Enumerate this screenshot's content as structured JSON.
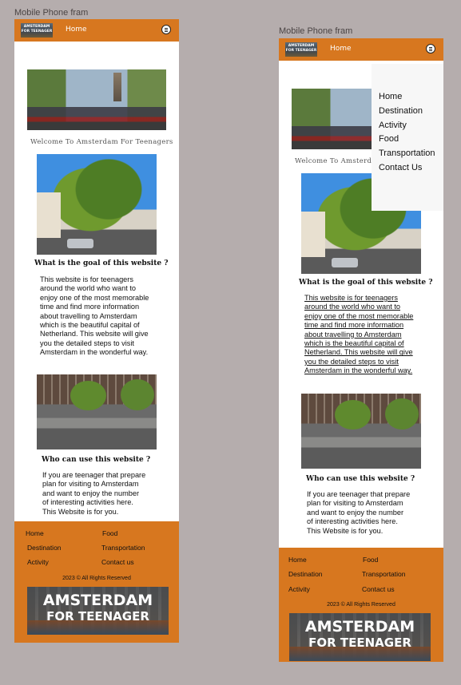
{
  "frames": [
    {
      "label": "Mobile Phone fram"
    },
    {
      "label": "Mobile Phone fram"
    }
  ],
  "nav": {
    "logo_text_line1": "AMSTERDAM",
    "logo_text_line2": "FOR TEENAGER",
    "home_label": "Home",
    "menu_icon": "hamburger-menu-icon"
  },
  "hero": {
    "welcome_text": "Welcome To Amsterdam For Teenagers"
  },
  "section_goal": {
    "heading": "What is the goal of this website ?",
    "text": "This website is for teenagers\naround the world who want to\nenjoy one of the most memorable\ntime and find more information\nabout travelling to Amsterdam\nwhich is the beautiful capital of\nNetherland. This website will give\nyou the detailed steps to visit\nAmsterdam in the wonderful way."
  },
  "section_who": {
    "heading": "Who can use this website ?",
    "text": "If you are teenager that prepare\nplan for visiting to Amsterdam\nand want to enjoy the number\nof interesting activities here.\nThis Website is for you."
  },
  "footer": {
    "links_left": [
      "Home",
      "Destination",
      "Activity"
    ],
    "links_right": [
      "Food",
      "Transportation",
      "Contact us"
    ],
    "copyright": "2023 © All Rights Reserved",
    "banner_line1": "AMSTERDAM",
    "banner_line2": "FOR TEENAGER"
  },
  "dropdown_menu": {
    "items": [
      "Home",
      "Destination",
      "Activity",
      "Food",
      "Transportation",
      "Contact Us"
    ]
  },
  "colors": {
    "accent": "#d7771f",
    "canvas_bg": "#b5adad"
  }
}
